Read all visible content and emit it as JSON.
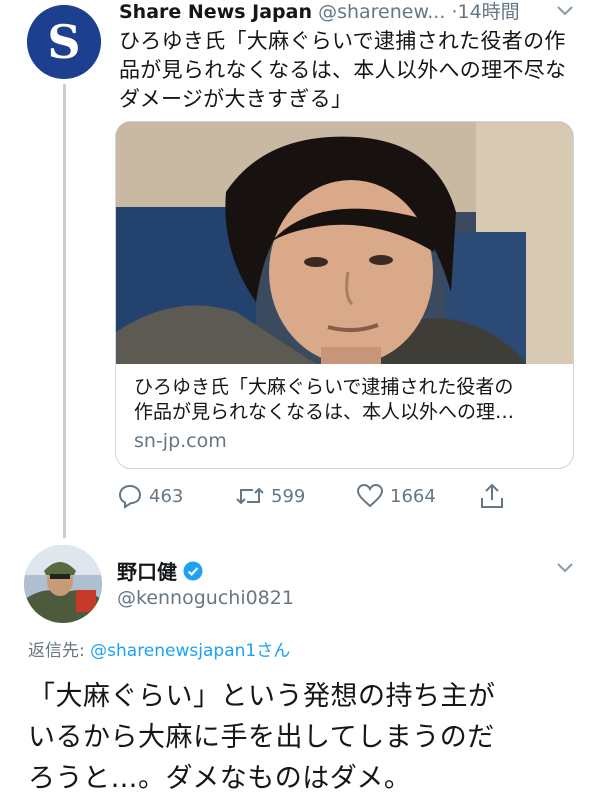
{
  "tweet1": {
    "author_name": "Share News Japan",
    "handle": "@sharenew...",
    "time": "·14時間",
    "text_lines": [
      "ひろゆき氏「大麻ぐらいで逮捕された役者の作",
      "品が見られなくなるは、本人以外への理不尽な",
      "ダメージが大きすぎる」"
    ],
    "card": {
      "title_line1": "ひろゆき氏「大麻ぐらいで逮捕された役者の",
      "title_line2": "作品が見られなくなるは、本人以外への理…",
      "domain": "sn-jp.com"
    },
    "actions": {
      "replies": "463",
      "retweets": "599",
      "likes": "1664"
    },
    "avatar_letter": "S"
  },
  "tweet2": {
    "author_name": "野口健",
    "handle": "@kennoguchi0821",
    "reply_prefix": "返信先: ",
    "reply_to": "@sharenewsjapan1さん",
    "text_lines": [
      "「大麻ぐらい」という発想の持ち主が",
      "いるから大麻に手を出してしまうのだ",
      "ろうと…。ダメなものはダメ。"
    ]
  },
  "colors": {
    "text": "#14171a",
    "secondary": "#657786",
    "link": "#1da1f2",
    "verified": "#1da1f2",
    "avatar_bg": "#1c3f8f",
    "divider": "#ccd6dd"
  },
  "icons": [
    "s-logo-icon",
    "chevron-down-icon",
    "reply-icon",
    "retweet-icon",
    "like-icon",
    "share-icon",
    "verified-badge-icon"
  ]
}
